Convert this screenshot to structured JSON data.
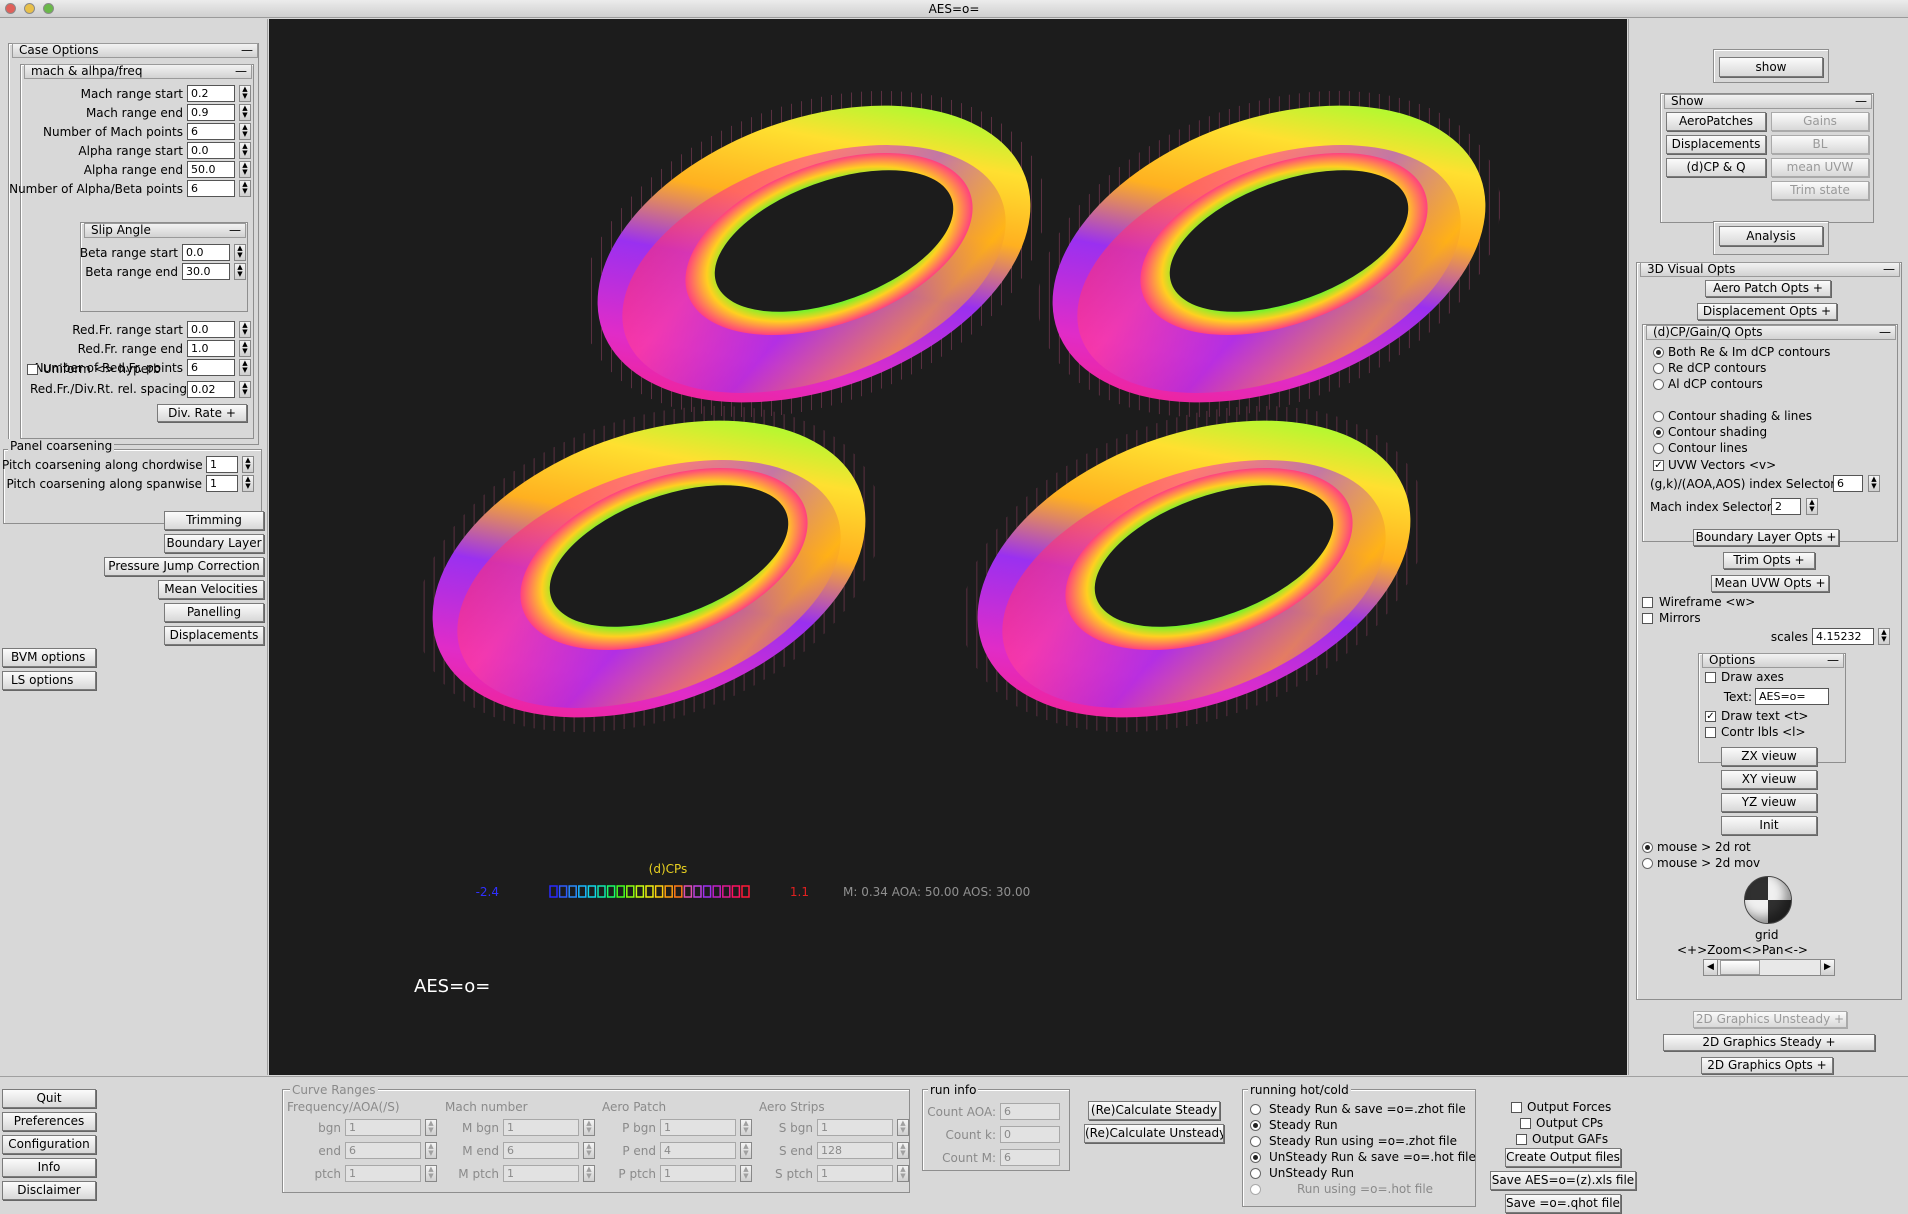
{
  "window": {
    "title": "AES=o="
  },
  "case_options": {
    "title": "Case Options",
    "mach_group": {
      "title": "mach & alhpa/freq",
      "fields": [
        {
          "label": "Mach range start",
          "value": "0.2"
        },
        {
          "label": "Mach range end",
          "value": "0.9"
        },
        {
          "label": "Number of Mach points",
          "value": "6"
        },
        {
          "label": "Alpha range start",
          "value": "0.0"
        },
        {
          "label": "Alpha range end",
          "value": "50.0"
        },
        {
          "label": "Number of Alpha/Beta points",
          "value": "6"
        }
      ]
    },
    "slip_group": {
      "title": "Slip Angle",
      "fields": [
        {
          "label": "Beta range start",
          "value": "0.0"
        },
        {
          "label": "Beta range end",
          "value": "30.0"
        }
      ]
    },
    "freq_fields": [
      {
        "label": "Red.Fr. range start",
        "value": "0.0"
      },
      {
        "label": "Red.Fr. range end",
        "value": "1.0"
      },
      {
        "label": "Number of Red.Fr. points",
        "value": "6"
      }
    ],
    "uniform_label": "Uniform <> hyperb",
    "spacing": {
      "label": "Red.Fr./Div.Rt. rel. spacing",
      "value": "0.02"
    },
    "div_rate_label": "Div. Rate"
  },
  "panel_coarsening": {
    "title": "Panel coarsening",
    "fields": [
      {
        "label": "Pitch coarsening along chordwise",
        "value": "1"
      },
      {
        "label": "Pitch coarsening along  spanwise",
        "value": "1"
      }
    ]
  },
  "left_buttons": [
    "Trimming",
    "Boundary Layer",
    "Pressure Jump Correction",
    "Mean Velocities",
    "Panelling",
    "Displacements"
  ],
  "options_buttons": [
    "BVM options",
    "LS  options"
  ],
  "canvas": {
    "legend_title": "(d)CPs",
    "legend_min": "-2.4",
    "legend_max": "1.1",
    "legend_info": "M: 0.34 AOA:  50.00 AOS:  30.00",
    "legend_colors": [
      "#2a2aff",
      "#2e5cff",
      "#2a8cff",
      "#1ab8ff",
      "#12d6e6",
      "#10e8b0",
      "#1aff6a",
      "#44ff22",
      "#8cff10",
      "#c8ff10",
      "#f0f010",
      "#ffd010",
      "#ffa010",
      "#ff7a18",
      "#e050b0",
      "#c040e0",
      "#a030f0",
      "#c020c8",
      "#e01890",
      "#ff1060",
      "#ff1838"
    ],
    "overlay_text": "AES=o="
  },
  "right_panel": {
    "show_button": "show",
    "show_group": {
      "title": "Show",
      "left_buttons": [
        "AeroPatches",
        "Displacements",
        "(d)CP & Q"
      ],
      "right_buttons": [
        "Gains",
        "BL",
        "mean UVW",
        "Trim state"
      ]
    },
    "analysis_button": "Analysis",
    "visual_opts": {
      "title": "3D Visual Opts",
      "aero_patch": "Aero Patch Opts",
      "displacement": "Displacement  Opts",
      "cp_group": {
        "title": "(d)CP/Gain/Q  Opts",
        "radios_a": [
          "Both Re & Im dCP contours",
          "Re dCP contours",
          "Al dCP contours"
        ],
        "radios_b": [
          "Contour shading & lines",
          "Contour shading",
          "Contour lines"
        ],
        "uvw_label": "UVW Vectors <v>",
        "index_selector": {
          "label": "(g,k)/(AOA,AOS) index Selector",
          "value": "6"
        },
        "mach_selector": {
          "label": "Mach index Selector",
          "value": "2"
        }
      },
      "boundary_layer": "Boundary Layer Opts",
      "trim": "Trim  Opts",
      "mean_uvw": "Mean UVW Opts",
      "wireframe": "Wireframe <w>",
      "mirrors": "Mirrors",
      "scales": {
        "label": "scales",
        "value": "4.15232"
      },
      "options_group": {
        "title": "Options",
        "draw_axes": "Draw axes",
        "text_label": "Text:",
        "text_value": "AES=o=",
        "draw_text": "Draw  text <t>",
        "contr_lbls": "Contr lbls <l>"
      },
      "view_buttons": [
        "ZX vieuw",
        "XY vieuw",
        "YZ vieuw",
        "Init"
      ],
      "mouse_modes": [
        "mouse > 2d rot",
        "mouse > 2d mov"
      ],
      "grid_label": "grid",
      "zoom_label": "<+>Zoom<>Pan<->"
    },
    "graphics_2d": [
      "2D Graphics Unsteady",
      "2D Graphics Steady",
      "2D Graphics Opts"
    ]
  },
  "bottom": {
    "menu_buttons": [
      "Quit",
      "Preferences",
      "Configuration",
      "Info",
      "Disclaimer"
    ],
    "curve_ranges": {
      "title": "Curve Ranges",
      "col_titles": [
        "Frequency/AOA(/S)",
        "Mach number",
        "Aero Patch",
        "Aero Strips"
      ],
      "rows": [
        {
          "labels": [
            "bgn",
            "M bgn",
            "P bgn",
            "S bgn"
          ],
          "values": [
            "1",
            "1",
            "1",
            "1"
          ]
        },
        {
          "labels": [
            "end",
            "M end",
            "P end",
            "S end"
          ],
          "values": [
            "6",
            "6",
            "4",
            "128"
          ]
        },
        {
          "labels": [
            "ptch",
            "M ptch",
            "P ptch",
            "S ptch"
          ],
          "values": [
            "1",
            "1",
            "1",
            "1"
          ]
        }
      ]
    },
    "run_info": {
      "title": "run info",
      "fields": [
        {
          "label": "Count AOA:",
          "value": "6"
        },
        {
          "label": "Count k:",
          "value": "0"
        },
        {
          "label": "Count M:",
          "value": "6"
        }
      ]
    },
    "calc_buttons": [
      "(Re)Calculate Steady",
      "(Re)Calculate Unsteady"
    ],
    "running": {
      "title": "running hot/cold",
      "options": [
        "Steady Run & save =o=.zhot file",
        "Steady Run",
        "Steady Run  using =o=.zhot file",
        "UnSteady Run & save =o=.hot file",
        "UnSteady Run",
        "Run  using =o=.hot file"
      ]
    },
    "output": {
      "forces": "Output Forces",
      "cps": "Output CPs",
      "gafs": "Output GAFs",
      "create": "Create Output files",
      "save_xls": "Save AES=o=(z).xls file",
      "save_qhot": "Save =o=.qhot file"
    }
  }
}
